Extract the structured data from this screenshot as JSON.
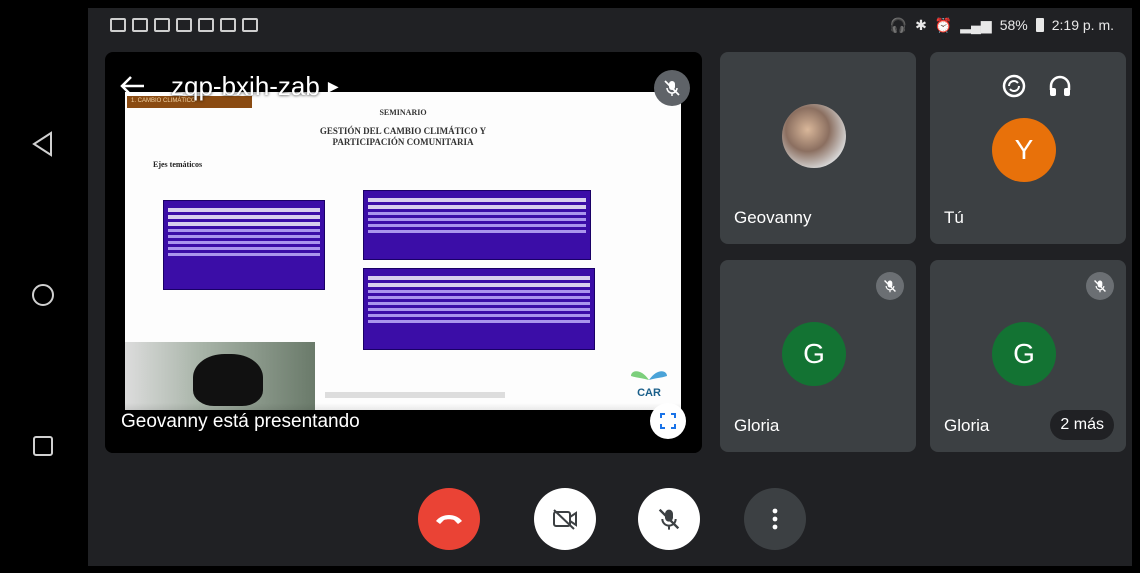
{
  "meeting": {
    "code": "zqp-bxih-zab",
    "presenting_text": "Geovanny está presentando"
  },
  "status": {
    "battery": "58%",
    "time": "2:19 p. m."
  },
  "slide": {
    "tag": "1. CAMBIO CLIMÁTICO",
    "heading": "SEMINARIO",
    "title": "GESTIÓN DEL CAMBIO CLIMÁTICO Y PARTICIPACIÓN COMUNITARIA",
    "subtitle": "Ejes temáticos",
    "logo_text": "CAR"
  },
  "participants": [
    {
      "name": "Geovanny",
      "avatar": "photo",
      "muted": false
    },
    {
      "name": "Tú",
      "avatar": "Y",
      "muted": false
    },
    {
      "name": "Gloria",
      "avatar": "G",
      "muted": true
    },
    {
      "name": "Gloria",
      "avatar": "G",
      "muted": true
    }
  ],
  "more_participants": "2 más",
  "colors": {
    "end_call": "#ea4335",
    "avatar_y": "#e8710a",
    "avatar_g": "#137333",
    "slide_box": "#3b0da7"
  },
  "icons": [
    "back-arrow-icon",
    "mic-off-icon",
    "camera-switch-icon",
    "headphones-icon",
    "fullscreen-icon",
    "end-call-icon",
    "video-off-icon",
    "more-vert-icon"
  ]
}
